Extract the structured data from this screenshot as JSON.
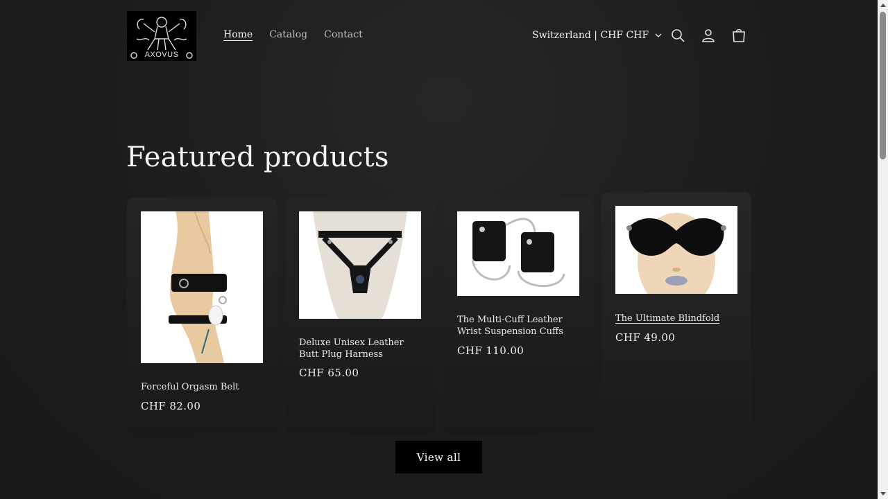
{
  "header": {
    "logo_text": "AXOVUS",
    "nav": [
      "Home",
      "Catalog",
      "Contact"
    ],
    "locale": "Switzerland | CHF CHF",
    "icons": [
      "search-icon",
      "account-icon",
      "cart-icon",
      "chevron-down-icon"
    ]
  },
  "section": {
    "title": "Featured products",
    "view_all": "View all"
  },
  "products": [
    {
      "name": "Forceful Orgasm Belt",
      "price": "CHF 82.00"
    },
    {
      "name": "Deluxe Unisex Leather Butt Plug Harness",
      "price": "CHF 65.00"
    },
    {
      "name": "The Multi-Cuff Leather Wrist Suspension Cuffs",
      "price": "CHF 110.00"
    },
    {
      "name": "The Ultimate Blindfold",
      "price": "CHF 49.00"
    }
  ],
  "colors": {
    "background": "#1c1c1c",
    "card": "#222222",
    "button": "#000000",
    "text": "#f2f2f2"
  }
}
